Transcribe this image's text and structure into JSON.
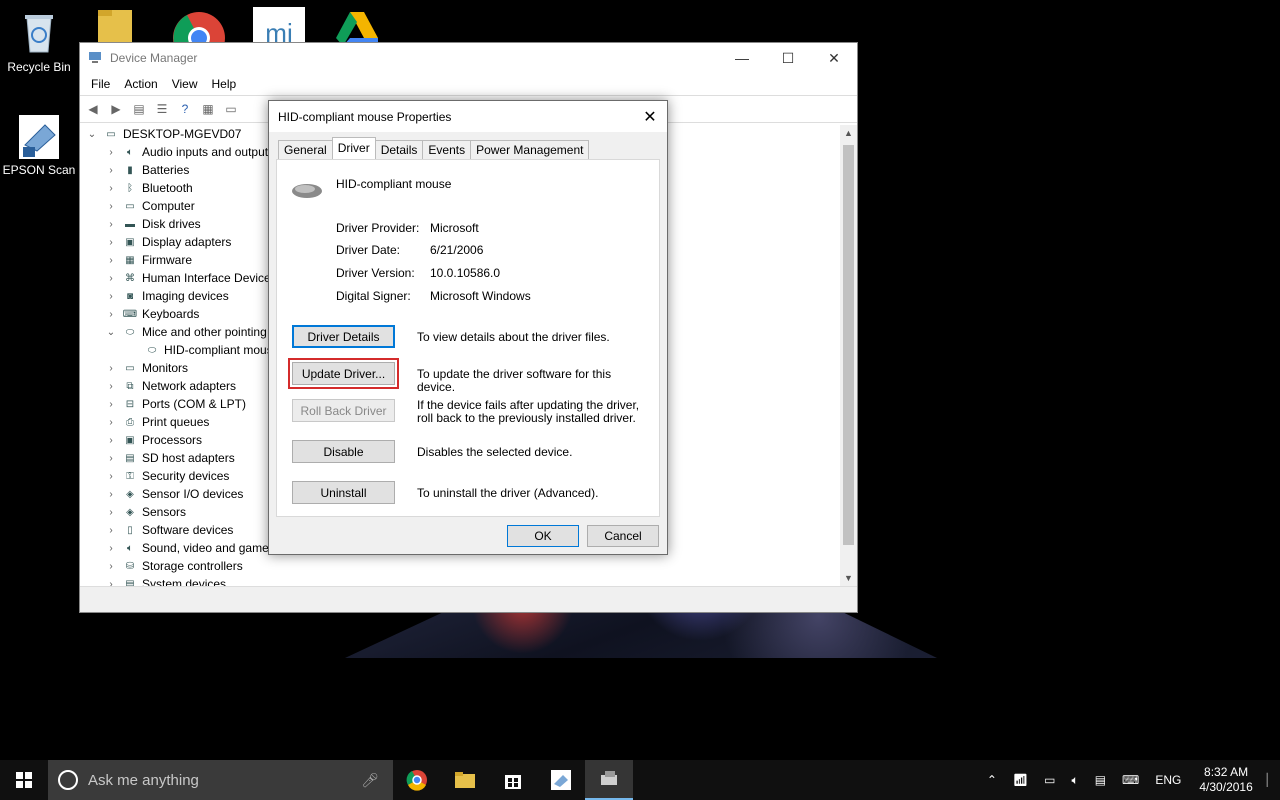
{
  "desktop": {
    "icons": [
      {
        "label": "Recycle Bin"
      },
      {
        "label": "EPSON Scan"
      }
    ]
  },
  "device_manager": {
    "title": "Device Manager",
    "menu": [
      "File",
      "Action",
      "View",
      "Help"
    ],
    "tree": {
      "root": "DESKTOP-MGEVD07",
      "items": [
        {
          "label": "Audio inputs and outputs",
          "icon": "speaker-icon"
        },
        {
          "label": "Batteries",
          "icon": "battery-icon"
        },
        {
          "label": "Bluetooth",
          "icon": "bluetooth-icon"
        },
        {
          "label": "Computer",
          "icon": "monitor-icon"
        },
        {
          "label": "Disk drives",
          "icon": "disk-icon"
        },
        {
          "label": "Display adapters",
          "icon": "display-adapter-icon"
        },
        {
          "label": "Firmware",
          "icon": "chip-icon"
        },
        {
          "label": "Human Interface Devices",
          "icon": "hid-icon"
        },
        {
          "label": "Imaging devices",
          "icon": "camera-icon"
        },
        {
          "label": "Keyboards",
          "icon": "keyboard-icon"
        },
        {
          "label": "Mice and other pointing devices",
          "icon": "mouse-icon",
          "expanded": true
        },
        {
          "label": "HID-compliant mouse",
          "icon": "mouse-icon",
          "child": true
        },
        {
          "label": "Monitors",
          "icon": "monitor-icon"
        },
        {
          "label": "Network adapters",
          "icon": "network-icon"
        },
        {
          "label": "Ports (COM & LPT)",
          "icon": "port-icon"
        },
        {
          "label": "Print queues",
          "icon": "printer-icon"
        },
        {
          "label": "Processors",
          "icon": "cpu-icon"
        },
        {
          "label": "SD host adapters",
          "icon": "sd-icon"
        },
        {
          "label": "Security devices",
          "icon": "security-icon"
        },
        {
          "label": "Sensor I/O devices",
          "icon": "sensor-icon"
        },
        {
          "label": "Sensors",
          "icon": "sensor-icon"
        },
        {
          "label": "Software devices",
          "icon": "software-icon"
        },
        {
          "label": "Sound, video and game controllers",
          "icon": "speaker-icon"
        },
        {
          "label": "Storage controllers",
          "icon": "storage-icon"
        },
        {
          "label": "System devices",
          "icon": "system-icon"
        }
      ]
    }
  },
  "dialog": {
    "title": "HID-compliant mouse Properties",
    "tabs": [
      "General",
      "Driver",
      "Details",
      "Events",
      "Power Management"
    ],
    "active_tab": "Driver",
    "device_name": "HID-compliant mouse",
    "info": [
      {
        "key": "Driver Provider:",
        "value": "Microsoft"
      },
      {
        "key": "Driver Date:",
        "value": "6/21/2006"
      },
      {
        "key": "Driver Version:",
        "value": "10.0.10586.0"
      },
      {
        "key": "Digital Signer:",
        "value": "Microsoft Windows"
      }
    ],
    "actions": [
      {
        "label": "Driver Details",
        "desc": "To view details about the driver files."
      },
      {
        "label": "Update Driver...",
        "desc": "To update the driver software for this device."
      },
      {
        "label": "Roll Back Driver",
        "desc": "If the device fails after updating the driver, roll back to the previously installed driver."
      },
      {
        "label": "Disable",
        "desc": "Disables the selected device."
      },
      {
        "label": "Uninstall",
        "desc": "To uninstall the driver (Advanced)."
      }
    ],
    "ok": "OK",
    "cancel": "Cancel",
    "highlight_color": "#d42b2b"
  },
  "taskbar": {
    "search_placeholder": "Ask me anything",
    "lang": "ENG",
    "time": "8:32 AM",
    "date": "4/30/2016"
  }
}
